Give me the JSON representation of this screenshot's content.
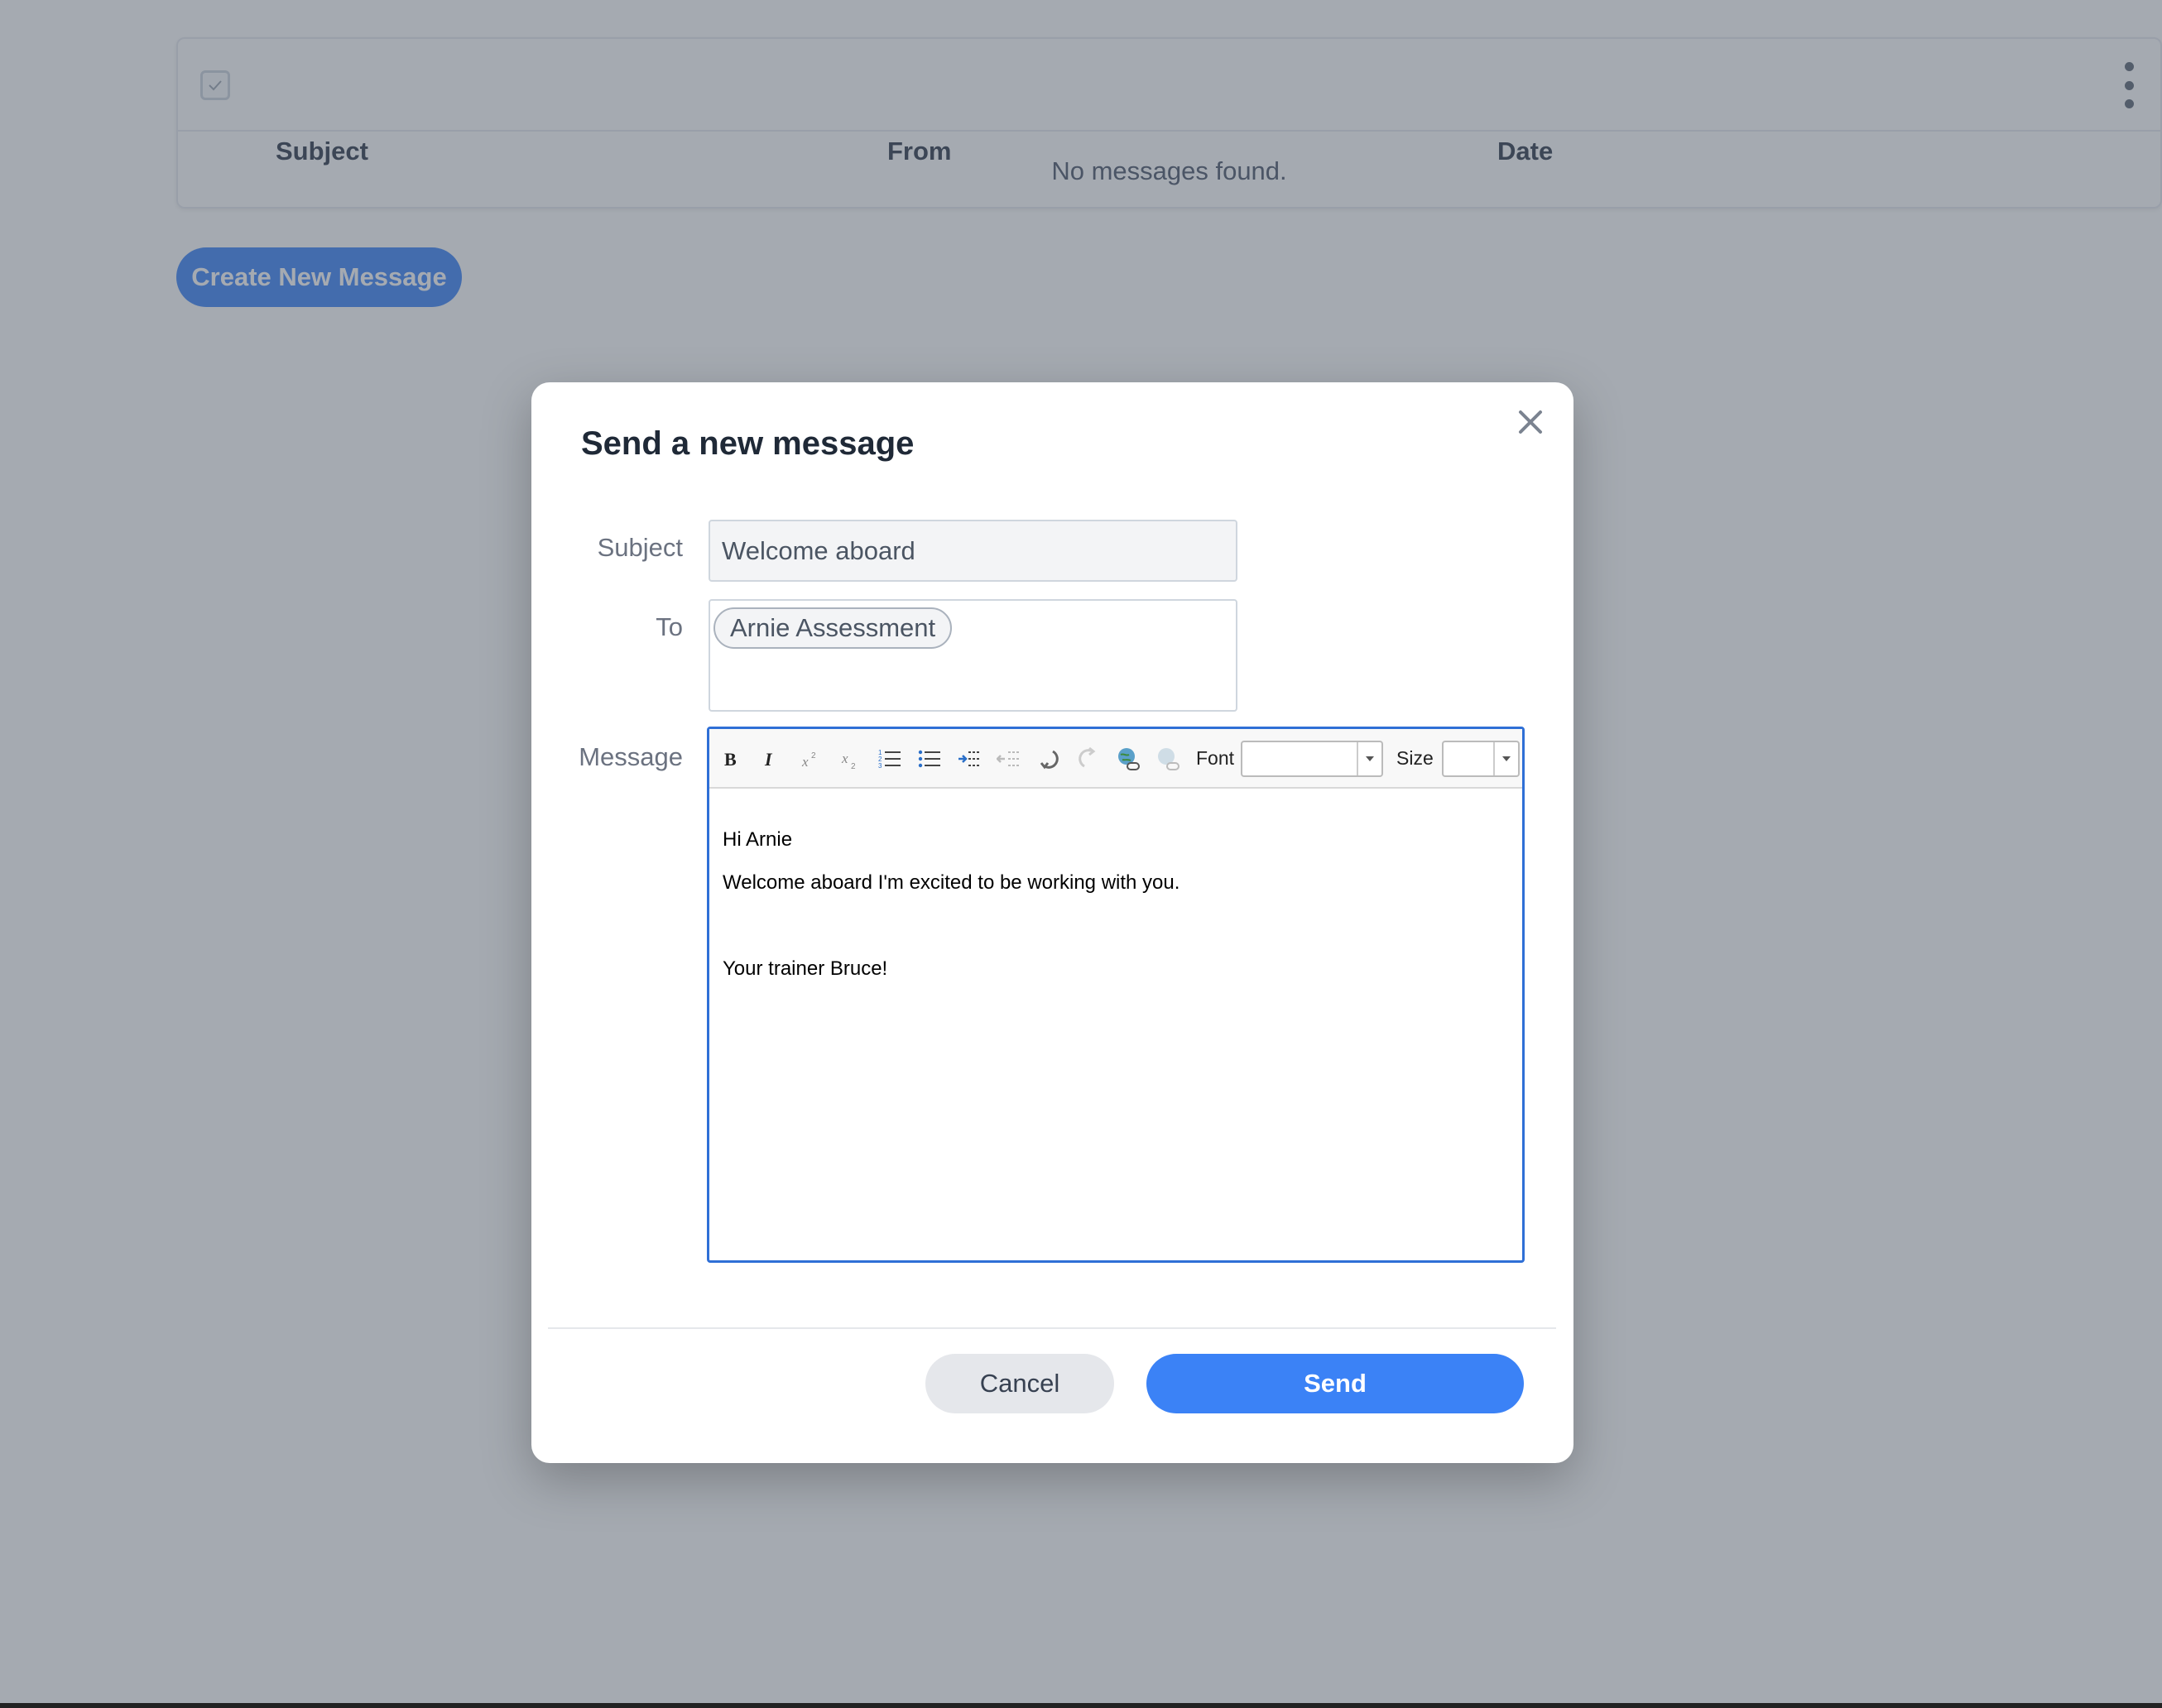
{
  "background": {
    "table": {
      "columns": {
        "subject": "Subject",
        "from": "From",
        "date": "Date"
      },
      "empty_text": "No messages found."
    },
    "create_button": "Create New Message"
  },
  "modal": {
    "title": "Send a new message",
    "labels": {
      "subject": "Subject",
      "to": "To",
      "message": "Message"
    },
    "subject_value": "Welcome aboard",
    "recipients": [
      "Arnie Assessment"
    ],
    "toolbar": {
      "font_label": "Font",
      "size_label": "Size",
      "font_value": "",
      "size_value": ""
    },
    "body_lines": [
      "Hi Arnie",
      "Welcome aboard I'm excited to be working with you.",
      "",
      "Your trainer Bruce!"
    ],
    "cancel_label": "Cancel",
    "send_label": "Send"
  },
  "colors": {
    "primary": "#3b82f6",
    "overlay": "rgba(75,85,99,0.5)",
    "editor_border": "#2f6fd6"
  }
}
